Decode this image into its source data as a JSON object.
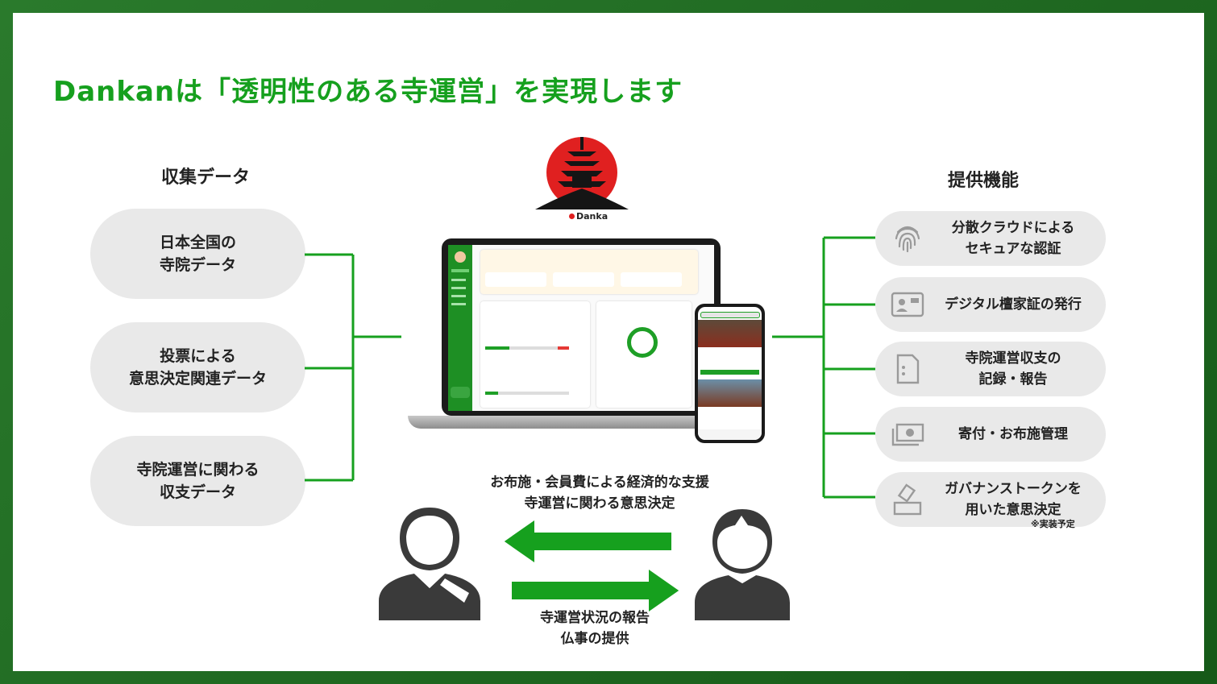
{
  "title": "Dankanは「透明性のある寺運営」を実現します",
  "left_header": "収集データ",
  "right_header": "提供機能",
  "left_items": [
    {
      "label": "日本全国の\n寺院データ"
    },
    {
      "label": "投票による\n意思決定関連データ"
    },
    {
      "label": "寺院運営に関わる\n収支データ"
    }
  ],
  "right_items": [
    {
      "label": "分散クラウドによる\nセキュアな認証",
      "icon": "fingerprint-icon"
    },
    {
      "label": "デジタル檀家証の発行",
      "icon": "id-card-icon"
    },
    {
      "label": "寺院運営収支の\n記録・報告",
      "icon": "document-icon"
    },
    {
      "label": "寄付・お布施管理",
      "icon": "money-icon"
    },
    {
      "label": "ガバナンストークンを\n用いた意思決定",
      "icon": "vote-icon"
    }
  ],
  "note": "※実装予定",
  "logo_text": "Danka",
  "top_caption": "お布施・会員費による経済的な支援\n寺運営に関わる意思決定",
  "bottom_caption": "寺運営状況の報告\n仏事の提供",
  "colors": {
    "accent": "#16a01e",
    "pill": "#e9e9e9",
    "frame": "#1f6f22",
    "sun": "#e02020"
  }
}
